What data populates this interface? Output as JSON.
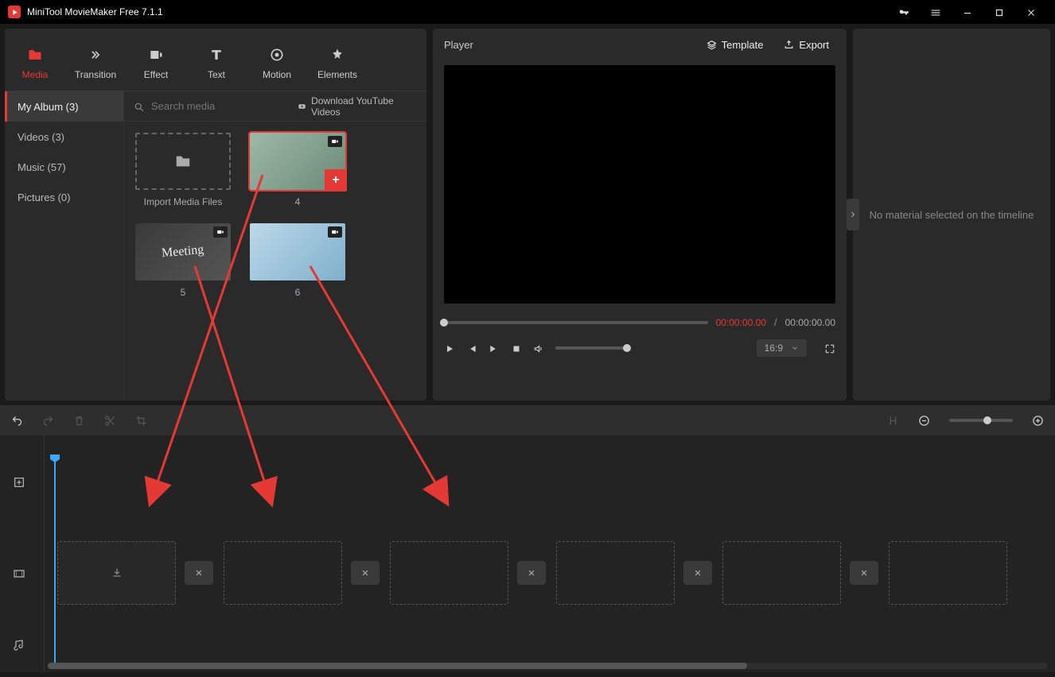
{
  "app": {
    "title": "MiniTool MovieMaker Free 7.1.1"
  },
  "tabs": {
    "media": "Media",
    "transition": "Transition",
    "effect": "Effect",
    "text": "Text",
    "motion": "Motion",
    "elements": "Elements"
  },
  "sidebar": {
    "my_album": "My Album (3)",
    "videos": "Videos (3)",
    "music": "Music (57)",
    "pictures": "Pictures (0)"
  },
  "search": {
    "placeholder": "Search media"
  },
  "download_yt": "Download YouTube Videos",
  "thumbs": {
    "import": "Import Media Files",
    "t4": "4",
    "t5": "5",
    "t6": "6"
  },
  "player": {
    "title": "Player",
    "template": "Template",
    "export": "Export",
    "time_current": "00:00:00.00",
    "time_sep": "/",
    "time_total": "00:00:00.00",
    "ratio": "16:9"
  },
  "inspector": {
    "empty": "No material selected on the timeline"
  }
}
